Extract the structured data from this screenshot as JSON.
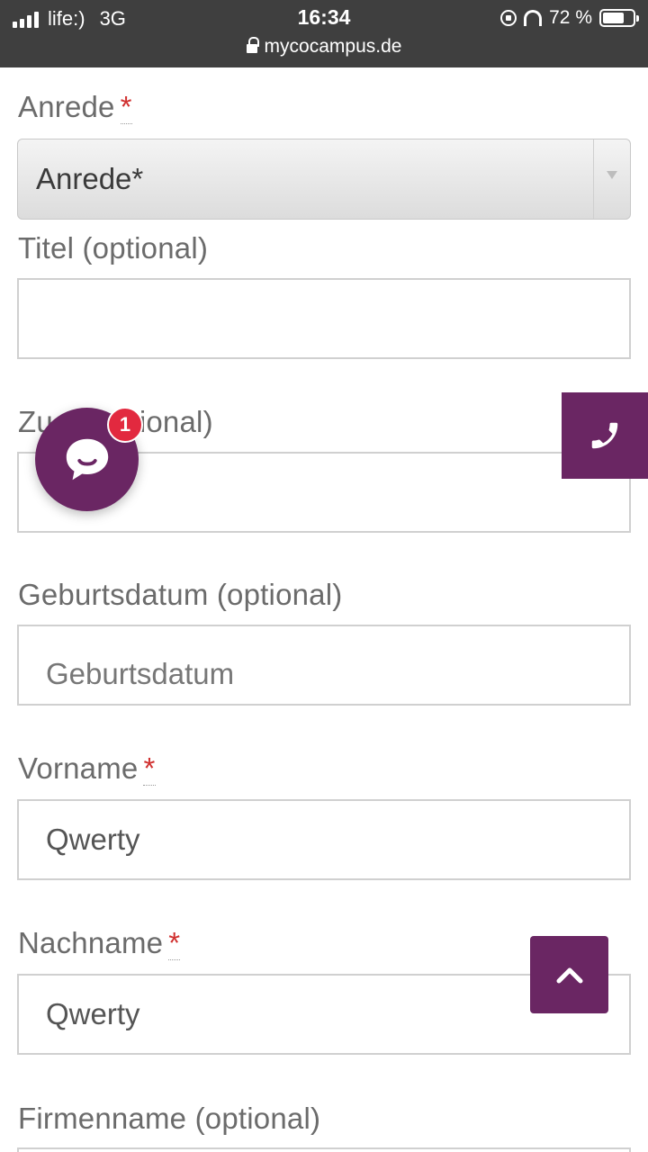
{
  "status_bar": {
    "carrier": "life:)",
    "network": "3G",
    "time": "16:34",
    "url": "mycocampus.de",
    "battery": "72 %",
    "battery_level": 0.72
  },
  "form": {
    "anrede": {
      "label": "Anrede",
      "required_mark": "*",
      "select_value": "Anrede*"
    },
    "titel": {
      "label": "Titel (optional)",
      "value": ""
    },
    "zusatz": {
      "label_visible_start": "Zu",
      "label_visible_end": "ptional)",
      "value": ""
    },
    "geburtsdatum": {
      "label": "Geburtsdatum (optional)",
      "placeholder": "Geburtsdatum"
    },
    "vorname": {
      "label": "Vorname",
      "required_mark": "*",
      "value": "Qwerty"
    },
    "nachname": {
      "label": "Nachname",
      "required_mark": "*",
      "value": "Qwerty"
    },
    "firmenname": {
      "label": "Firmenname (optional)"
    }
  },
  "chat_widget": {
    "badge_count": "1"
  },
  "colors": {
    "brand": "#6a2663",
    "badge": "#e2293f",
    "required": "#d0302f"
  }
}
